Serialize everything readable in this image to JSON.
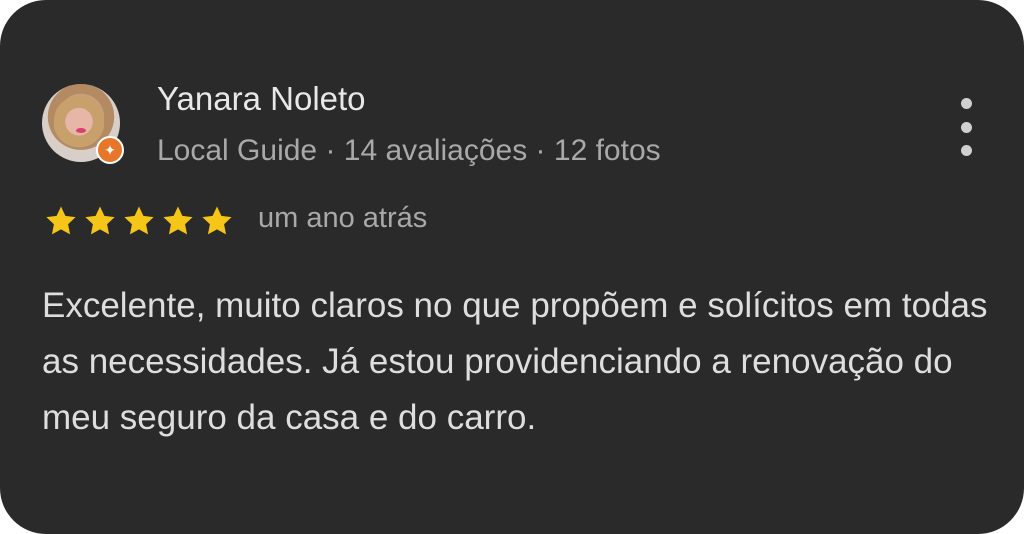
{
  "reviewer": {
    "name": "Yanara Noleto",
    "meta": "Local Guide · 14 avaliações · 12 fotos",
    "avatar": "user-avatar-photo",
    "badge_icon": "local-guide-star-icon",
    "badge_color": "#e8762a"
  },
  "rating": {
    "stars": 5,
    "max": 5,
    "star_color": "#f5c518",
    "time": "um ano atrás"
  },
  "review": {
    "text": "Excelente, muito claros no que propõem e solícitos em todas as necessidades. Já estou providenciando a renovação do meu seguro da casa e do carro."
  },
  "menu": {
    "icon": "more-vert-icon"
  },
  "theme": {
    "card_background": "#2a2a2a"
  }
}
